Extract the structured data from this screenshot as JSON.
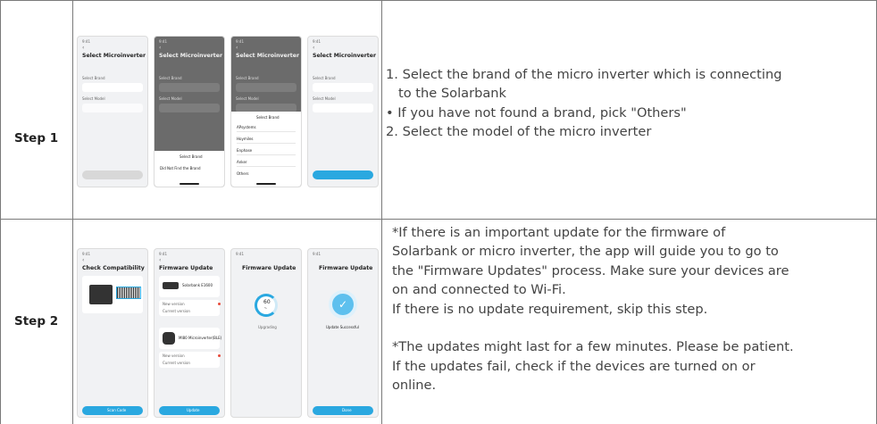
{
  "rows": [
    {
      "step_label": "Step 1",
      "phones": [
        {
          "time": "9:41",
          "title": "Select Microinverter",
          "field1_label": "Select Brand",
          "field2_label": "Select Model"
        },
        {
          "time": "9:41",
          "title": "Select Microinverter",
          "field1_label": "Select Brand",
          "field2_label": "Select Model",
          "sheet_title": "Select Brand",
          "sheet_item": "Did Not Find the Brand"
        },
        {
          "time": "9:41",
          "title": "Select Microinverter",
          "field1_label": "Select Brand",
          "field2_label": "Select Model",
          "sheet_title": "Select Brand",
          "sheet_items": [
            "APsystems",
            "Hoymiles",
            "Enphase",
            "Anker",
            "Others"
          ]
        },
        {
          "time": "9:41",
          "title": "Select Microinverter",
          "field1_label": "Select Brand",
          "field2_label": "Select Model"
        }
      ],
      "lines": [
        "1. Select the brand of the micro inverter which is connecting",
        "to the Solarbank",
        "•  If you have not found a brand, pick \"Others\"",
        "2. Select the model of the micro inverter"
      ]
    },
    {
      "step_label": "Step 2",
      "phones": [
        {
          "time": "9:41",
          "title": "Check Compatibility",
          "button": "Scan Code"
        },
        {
          "time": "9:41",
          "title": "Firmware Update",
          "device1": "Solarbank E1600",
          "device2": "MI80 Microinverter(BLE)",
          "new_version_label": "New version",
          "current_version_label": "Current version",
          "button": "Update"
        },
        {
          "time": "9:41",
          "title": "Firmware Update",
          "progress": 60,
          "progress_unit": "%",
          "status": "Upgrading"
        },
        {
          "time": "9:41",
          "title": "Firmware Update",
          "status": "Update Successful",
          "button": "Done"
        }
      ],
      "lines": [
        "*If there is an important update for the firmware of",
        "Solarbank or micro inverter, the app will guide you to go to",
        "the \"Firmware Updates\" process. Make sure your devices are",
        "on and connected to Wi-Fi.",
        "If there is no update requirement, skip this step.",
        "",
        "*The updates might last for a few minutes. Please be patient.",
        "If the updates fail, check if the devices are turned on or",
        "online."
      ]
    }
  ],
  "colors": {
    "accent": "#2aa8e0",
    "border": "#7a7a7a",
    "text": "#444444"
  }
}
